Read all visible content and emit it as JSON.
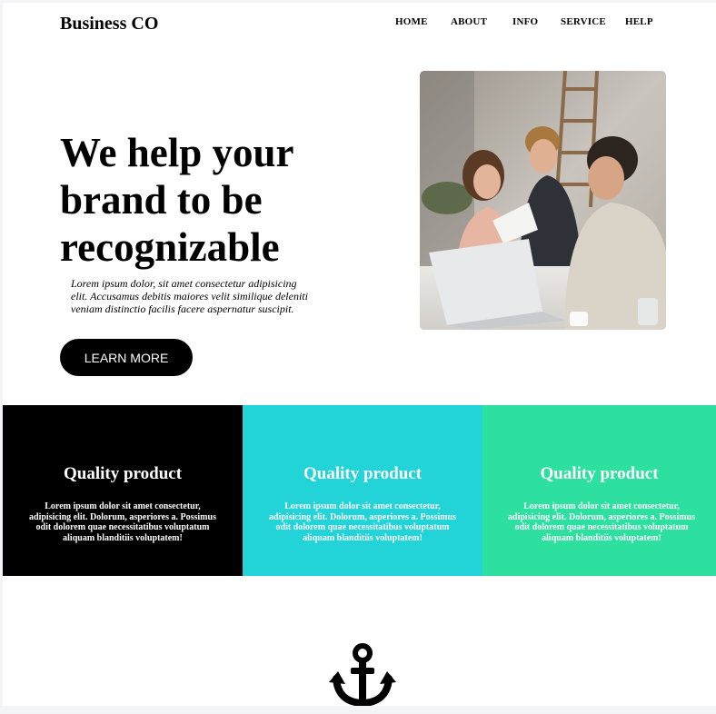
{
  "header": {
    "brand": "Business CO",
    "nav": [
      {
        "label": "HOME"
      },
      {
        "label": "ABOUT"
      },
      {
        "label": "INFO"
      },
      {
        "label": "SERVICE"
      },
      {
        "label": "HELP"
      }
    ]
  },
  "hero": {
    "title": "We help your brand to be recognizable",
    "text": "Lorem ipsum dolor, sit amet consectetur adipisicing elit. Accusamus debitis maiores velit similique deleniti veniam distinctio facilis facere aspernatur suscipit.",
    "cta_label": "LEARN MORE"
  },
  "features": [
    {
      "title": "Quality product",
      "text": "Lorem ipsum dolor sit amet consectetur, adipisicing elit. Dolorum, asperiores a. Possimus odit dolorem quae necessitatibus voluptatum aliquam blanditiis voluptatem!",
      "color": "#000000"
    },
    {
      "title": "Quality product",
      "text": "Lorem ipsum dolor sit amet consectetur, adipisicing elit. Dolorum, asperiores a. Possimus odit dolorem quae necessitatibus voluptatum aliquam blanditiis voluptatem!",
      "color": "#22d3d7"
    },
    {
      "title": "Quality product",
      "text": "Lorem ipsum dolor sit amet consectetur, adipisicing elit. Dolorum, asperiores a. Possimus odit dolorem quae necessitatibus voluptatum aliquam blanditiis voluptatem!",
      "color": "#2de0a0"
    }
  ],
  "icons": {
    "anchor": "anchor-icon"
  }
}
